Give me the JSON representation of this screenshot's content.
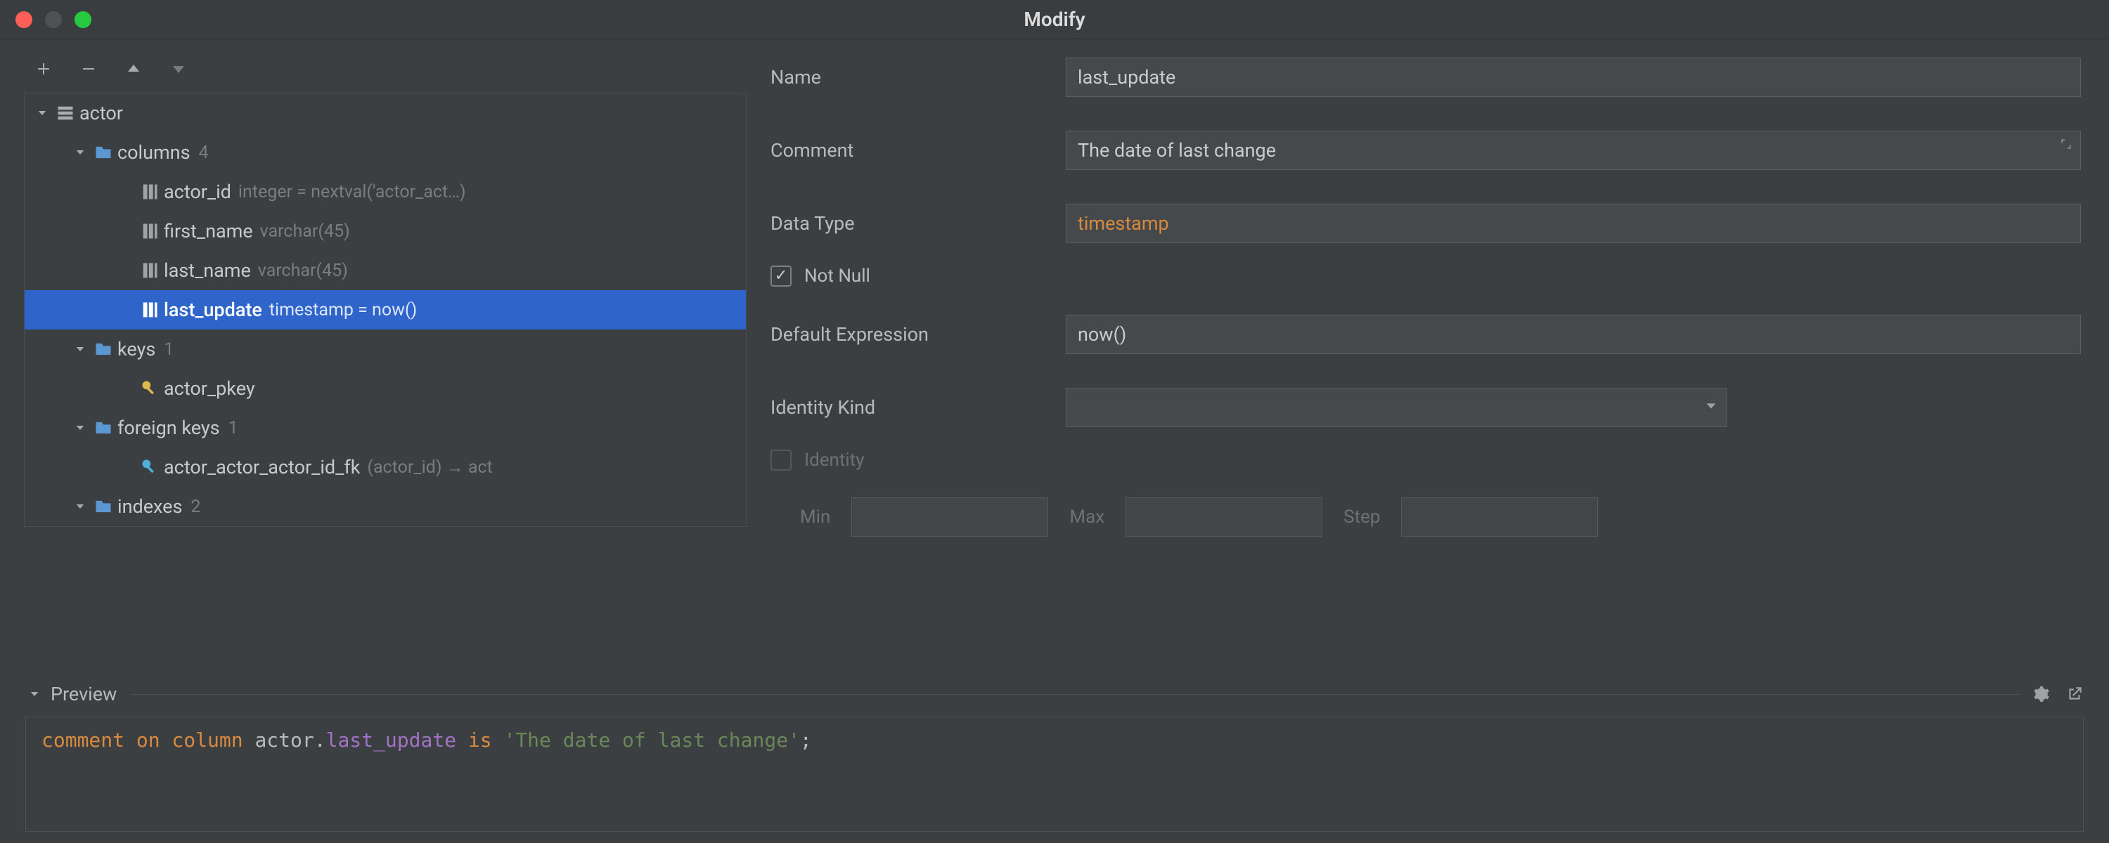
{
  "window": {
    "title": "Modify"
  },
  "toolbar": {
    "add": "+",
    "remove": "−",
    "up": "▲",
    "down": "▼"
  },
  "tree": {
    "root": {
      "name": "actor"
    },
    "columns_group": {
      "label": "columns",
      "count": "4"
    },
    "columns": [
      {
        "name": "actor_id",
        "type": "integer = nextval('actor_act…)"
      },
      {
        "name": "first_name",
        "type": "varchar(45)"
      },
      {
        "name": "last_name",
        "type": "varchar(45)"
      },
      {
        "name": "last_update",
        "type": "timestamp = now()"
      }
    ],
    "keys_group": {
      "label": "keys",
      "count": "1"
    },
    "keys": [
      {
        "name": "actor_pkey"
      }
    ],
    "fkeys_group": {
      "label": "foreign keys",
      "count": "1"
    },
    "fkeys": [
      {
        "name": "actor_actor_actor_id_fk",
        "detail": "(actor_id) → act"
      }
    ],
    "indexes_group": {
      "label": "indexes",
      "count": "2"
    }
  },
  "form": {
    "name_label": "Name",
    "name_value": "last_update",
    "comment_label": "Comment",
    "comment_value": "The date of last change",
    "datatype_label": "Data Type",
    "datatype_value": "timestamp",
    "notnull_label": "Not Null",
    "default_label": "Default Expression",
    "default_value": "now()",
    "identity_kind_label": "Identity Kind",
    "identity_kind_value": "",
    "identity_label": "Identity",
    "min_label": "Min",
    "max_label": "Max",
    "step_label": "Step"
  },
  "preview": {
    "label": "Preview",
    "sql": {
      "kw1": "comment ",
      "kw2": "on column ",
      "tbl": "actor",
      "dot": ".",
      "col": "last_update",
      "kw3": " is ",
      "str": "'The date of last change'",
      "semi": ";"
    }
  }
}
